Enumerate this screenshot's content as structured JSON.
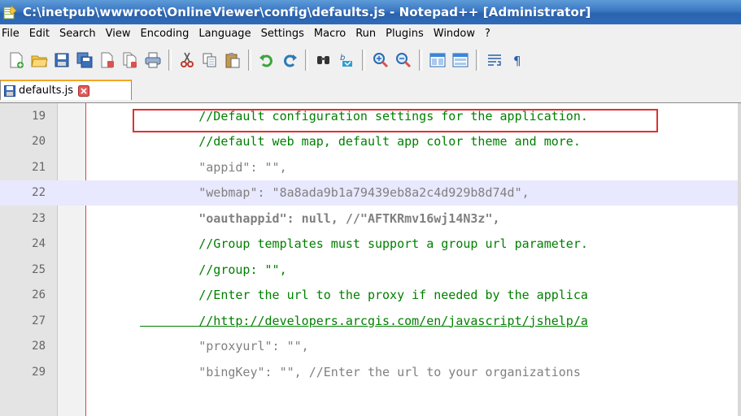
{
  "window": {
    "title": "C:\\inetpub\\wwwroot\\OnlineViewer\\config\\defaults.js - Notepad++ [Administrator]"
  },
  "menu": [
    "File",
    "Edit",
    "Search",
    "View",
    "Encoding",
    "Language",
    "Settings",
    "Macro",
    "Run",
    "Plugins",
    "Window",
    "?"
  ],
  "toolbar": {
    "icons": [
      "new-file-icon",
      "open-file-icon",
      "save-icon",
      "save-all-icon",
      "close-icon",
      "close-all-icon",
      "print-icon",
      "cut-icon",
      "copy-icon",
      "paste-icon",
      "undo-icon",
      "redo-icon",
      "find-icon",
      "replace-icon",
      "zoom-in-icon",
      "zoom-out-icon",
      "sync-vertical-icon",
      "sync-horizontal-icon",
      "word-wrap-icon",
      "show-all-chars-icon"
    ]
  },
  "tab": {
    "label": "defaults.js"
  },
  "editor": {
    "lines": [
      {
        "num": "19",
        "text": "        //Default configuration settings for the application."
      },
      {
        "num": "20",
        "text": "        //default web map, default app color theme and more."
      },
      {
        "num": "21",
        "text": "        \"appid\": \"\","
      },
      {
        "num": "22",
        "text": "        \"webmap\": \"8a8ada9b1a79439eb8a2c4d929b8d74d\","
      },
      {
        "num": "23",
        "text": "        \"oauthappid\": null, //\"AFTKRmv16wj14N3z\","
      },
      {
        "num": "24",
        "text": "        //Group templates must support a group url parameter."
      },
      {
        "num": "25",
        "text": "        //group: \"\","
      },
      {
        "num": "26",
        "text": "        //Enter the url to the proxy if needed by the applica"
      },
      {
        "num": "27",
        "text": "        //http://developers.arcgis.com/en/javascript/jshelp/a"
      },
      {
        "num": "28",
        "text": "        \"proxyurl\": \"\","
      },
      {
        "num": "29",
        "text": "        \"bingKey\": \"\", //Enter the url to your organizations"
      }
    ],
    "highlighted_line": "22"
  },
  "colors": {
    "comment": "#008000",
    "string": "#808080",
    "highlight_box": "#e03030",
    "current_line": "#e8e8ff"
  }
}
